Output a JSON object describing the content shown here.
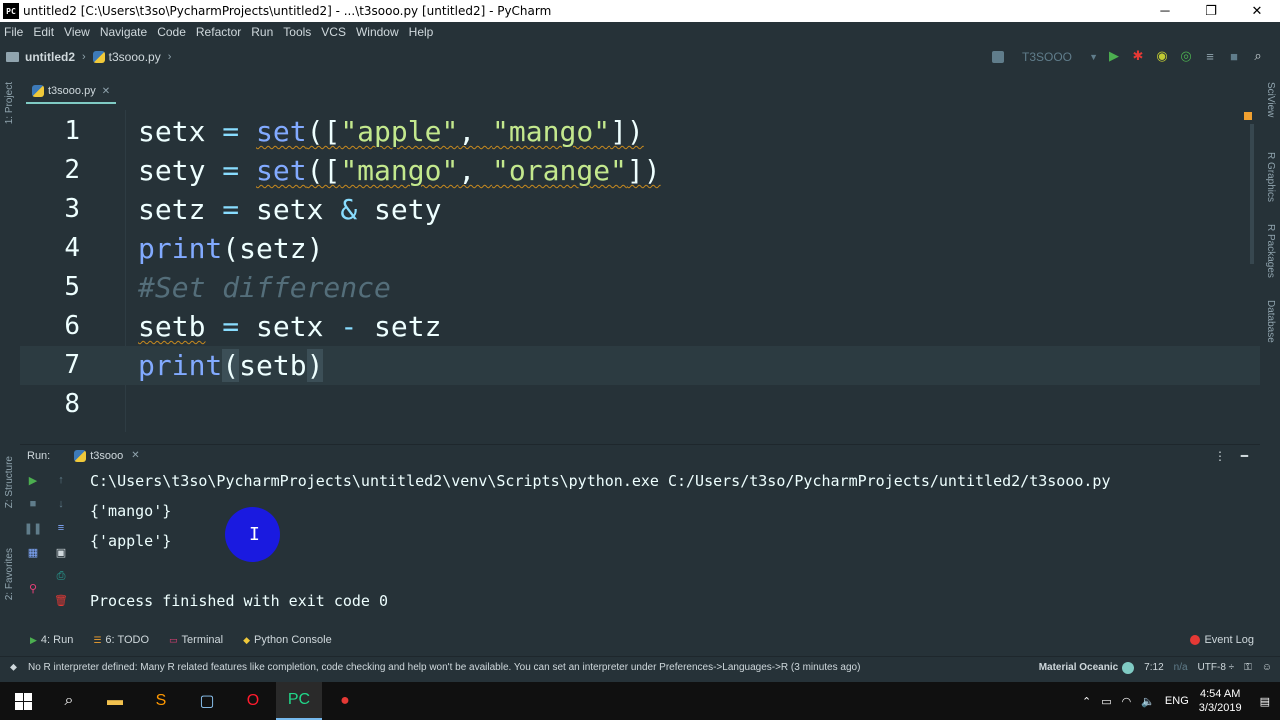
{
  "window": {
    "title": "untitled2 [C:\\Users\\t3so\\PycharmProjects\\untitled2] - ...\\t3sooo.py [untitled2] - PyCharm",
    "app_icon_text": "PC",
    "minimize": "─",
    "maximize": "❐",
    "close": "✕"
  },
  "menu": [
    "File",
    "Edit",
    "View",
    "Navigate",
    "Code",
    "Refactor",
    "Run",
    "Tools",
    "VCS",
    "Window",
    "Help"
  ],
  "nav": {
    "project": "untitled2",
    "file": "t3sooo.py",
    "run_config": "T3SOOO"
  },
  "left_tabs": {
    "project": "1: Project",
    "structure": "Z: Structure",
    "favorites": "2: Favorites"
  },
  "right_tabs": {
    "sciview": "SciView",
    "r_graphics": "R Graphics",
    "r_packages": "R Packages",
    "database": "Database"
  },
  "editor": {
    "tab_name": "t3sooo.py",
    "line_numbers": [
      "1",
      "2",
      "3",
      "4",
      "5",
      "6",
      "7",
      "8"
    ]
  },
  "run_panel": {
    "label": "Run:",
    "tab_name": "t3sooo",
    "output": [
      "C:\\Users\\t3so\\PycharmProjects\\untitled2\\venv\\Scripts\\python.exe C:/Users/t3so/PycharmProjects/untitled2/t3sooo.py",
      "{'mango'}",
      "{'apple'}",
      "",
      "Process finished with exit code 0"
    ]
  },
  "bottom_tools": {
    "run": "4: Run",
    "todo": "6: TODO",
    "terminal": "Terminal",
    "python_console": "Python Console",
    "event_log": "Event Log"
  },
  "status": {
    "message": "No R interpreter defined: Many R related features like completion, code checking and help won't be available. You can set an interpreter under Preferences->Languages->R (3 minutes ago)",
    "theme": "Material Oceanic",
    "position": "7:12",
    "na": "n/a",
    "encoding": "UTF-8 ÷"
  },
  "taskbar": {
    "language": "ENG",
    "time": "4:54 AM",
    "date": "3/3/2019"
  },
  "colors": {
    "background": "#263238",
    "keyword": "#82aaff",
    "string": "#c3e88d",
    "comment": "#546e7a",
    "accent": "#80cbc4"
  }
}
